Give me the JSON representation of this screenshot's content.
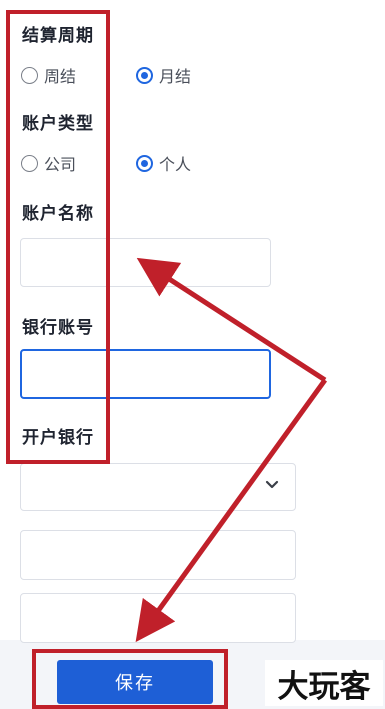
{
  "form": {
    "settlement_cycle": {
      "label": "结算周期",
      "options": [
        {
          "label": "周结",
          "checked": false
        },
        {
          "label": "月结",
          "checked": true
        }
      ]
    },
    "account_type": {
      "label": "账户类型",
      "options": [
        {
          "label": "公司",
          "checked": false
        },
        {
          "label": "个人",
          "checked": true
        }
      ]
    },
    "account_name": {
      "label": "账户名称",
      "value": ""
    },
    "bank_account": {
      "label": "银行账号",
      "value": ""
    },
    "opening_bank": {
      "label": "开户银行",
      "selected": "",
      "extra_field_1_value": "",
      "extra_field_2_value": ""
    }
  },
  "footer": {
    "save_label": "保存"
  },
  "watermark": {
    "text": "大玩客"
  },
  "colors": {
    "accent": "#1f66e0",
    "button": "#1e5fd6",
    "annotation": "#c0202a"
  }
}
